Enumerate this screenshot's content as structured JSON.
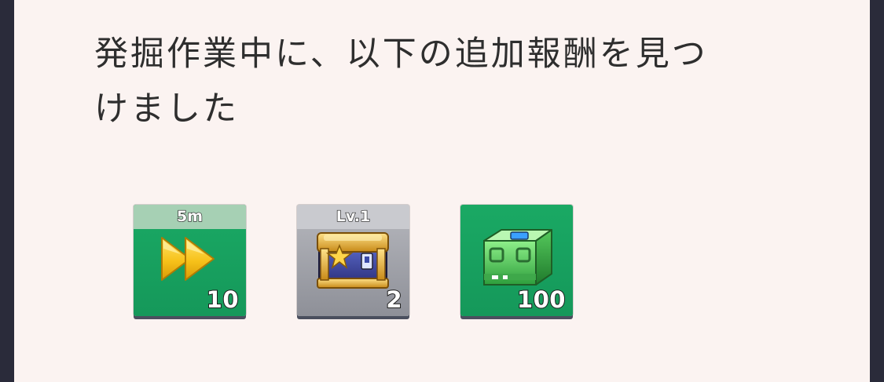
{
  "message": {
    "line1": "発掘作業中に、以下の追加報酬を見つ",
    "line2": "けました"
  },
  "rewards": [
    {
      "icon": "fast-forward-icon",
      "header": "5m",
      "count": "10"
    },
    {
      "icon": "treasure-chest-icon",
      "header": "Lv.1",
      "count": "2"
    },
    {
      "icon": "green-supply-crate-icon",
      "count": "100"
    }
  ],
  "colors": {
    "panel_bg": "#fbf3f1",
    "side_bg": "#2a2b3a",
    "tile_green": "#1aa964",
    "tile_gray": "#a0a1a8",
    "text": "#2e2e2e"
  }
}
